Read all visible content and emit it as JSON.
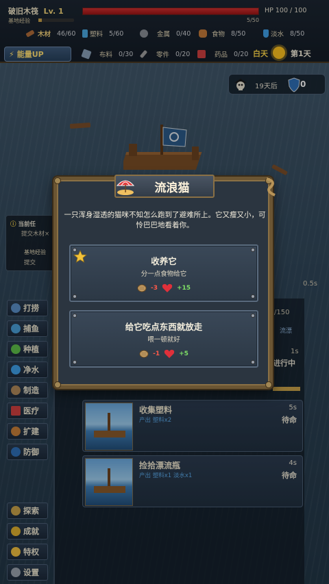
{
  "header": {
    "raft_name": "破旧木筏",
    "level": "Lv. 1",
    "base_exp_label": "基地经验",
    "base_exp_value": "5/50",
    "base_exp_fraction": 0.1,
    "hp_text": "HP 100 / 100",
    "hp_fraction": 1.0
  },
  "resources_row1": [
    {
      "icon": "wood-icon",
      "name": "木材",
      "value": "46/60",
      "color": "#b06c3a"
    },
    {
      "icon": "plastic-icon",
      "name": "塑料",
      "value": "5/60",
      "color": "#4aa8e0"
    },
    {
      "icon": "gear-icon",
      "name": "金属",
      "value": "0/40",
      "color": "#8a8f96"
    },
    {
      "icon": "food-icon",
      "name": "食物",
      "value": "8/50",
      "color": "#c47a3a"
    },
    {
      "icon": "water-icon",
      "name": "淡水",
      "value": "8/50",
      "color": "#3fa0e8"
    }
  ],
  "resources_row2": [
    {
      "icon": "cloth-icon",
      "name": "布料",
      "value": "0/30",
      "color": "#8aa0b8"
    },
    {
      "icon": "wrench-icon",
      "name": "零件",
      "value": "0/20",
      "color": "#a0a0a0"
    },
    {
      "icon": "medkit-icon",
      "name": "药品",
      "value": "0/20",
      "color": "#d04040"
    }
  ],
  "energy_button": "能量UP",
  "time_of_day": "白天",
  "day_label": "第1天",
  "pirate": {
    "text": "19天后",
    "defense": "0"
  },
  "task_panel": {
    "line1": "当前任",
    "line2": "提交木材×",
    "line3": "基地经验",
    "line4": "提交"
  },
  "side_menu": [
    {
      "icon": "fishing-hook-icon",
      "label": "打捞"
    },
    {
      "icon": "fish-icon",
      "label": "捕鱼"
    },
    {
      "icon": "sprout-icon",
      "label": "种植"
    },
    {
      "icon": "water-drop-icon",
      "label": "净水"
    },
    {
      "icon": "hammer-icon",
      "label": "制造"
    },
    {
      "icon": "medkit-icon",
      "label": "医疗"
    },
    {
      "icon": "flag-icon",
      "label": "扩建"
    },
    {
      "icon": "shield-icon",
      "label": "防御"
    }
  ],
  "side_menu_bottom": [
    {
      "icon": "compass-icon",
      "label": "探索"
    },
    {
      "icon": "trophy-icon",
      "label": "成就"
    },
    {
      "icon": "star-icon",
      "label": "特权"
    },
    {
      "icon": "gear-icon",
      "label": "设置"
    }
  ],
  "peek": {
    "timer": "0.5s",
    "count": "/150",
    "tab": "流漂",
    "time_1s": "1s",
    "in_progress": "进行中"
  },
  "tasks": [
    {
      "title": "收集塑料",
      "sub": "产出 塑料x2",
      "time": "5s",
      "status": "待命"
    },
    {
      "title": "捡拾漂流瓶",
      "sub": "产出 塑料x1 淡水x1",
      "time": "4s",
      "status": "待命"
    }
  ],
  "dialog": {
    "title": "流浪猫",
    "description": "一只浑身湿透的猫咪不知怎么跑到了避难所上。它又瘦又小，可怜巴巴地看着你。",
    "choices": [
      {
        "title": "收养它",
        "desc": "分一点食物给它",
        "food": "-3",
        "health": "+15",
        "starred": true
      },
      {
        "title": "给它吃点东西就放走",
        "desc": "喂一顿就好",
        "food": "-1",
        "health": "+5",
        "starred": false
      }
    ]
  }
}
